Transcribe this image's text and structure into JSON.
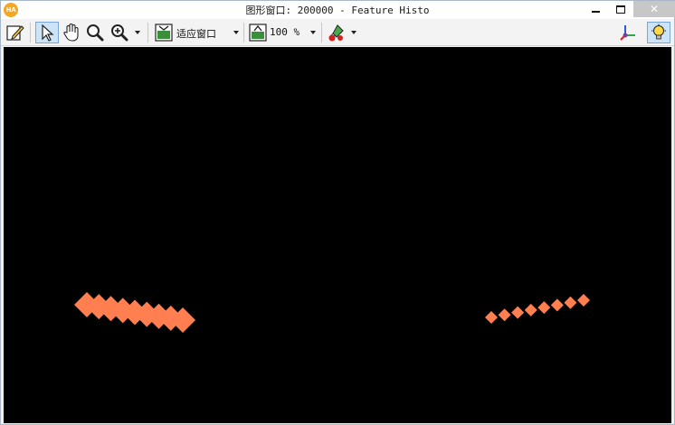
{
  "window": {
    "title": "图形窗口: 200000 - Feature Histo",
    "app_logo_text": "HA",
    "close_symbol": "✕"
  },
  "toolbar": {
    "zoom_mode_label": "适应窗口",
    "zoom_percent_label": "100 %",
    "tools": [
      {
        "name": "edit-pencil-icon"
      },
      {
        "name": "pointer-icon",
        "active": true
      },
      {
        "name": "hand-pan-icon"
      },
      {
        "name": "magnifier-icon"
      },
      {
        "name": "zoom-in-icon"
      },
      {
        "name": "fit-window-icon"
      },
      {
        "name": "zoom-percent-icon"
      },
      {
        "name": "color-paint-icon"
      },
      {
        "name": "axes-3d-icon"
      },
      {
        "name": "lightbulb-icon",
        "active": true
      }
    ]
  },
  "canvas": {
    "background": "#000000",
    "region_color": "#ff7f50",
    "regions": [
      {
        "name": "left-feature-region",
        "description_count": 9
      },
      {
        "name": "right-feature-region",
        "description_count": 8
      }
    ]
  }
}
